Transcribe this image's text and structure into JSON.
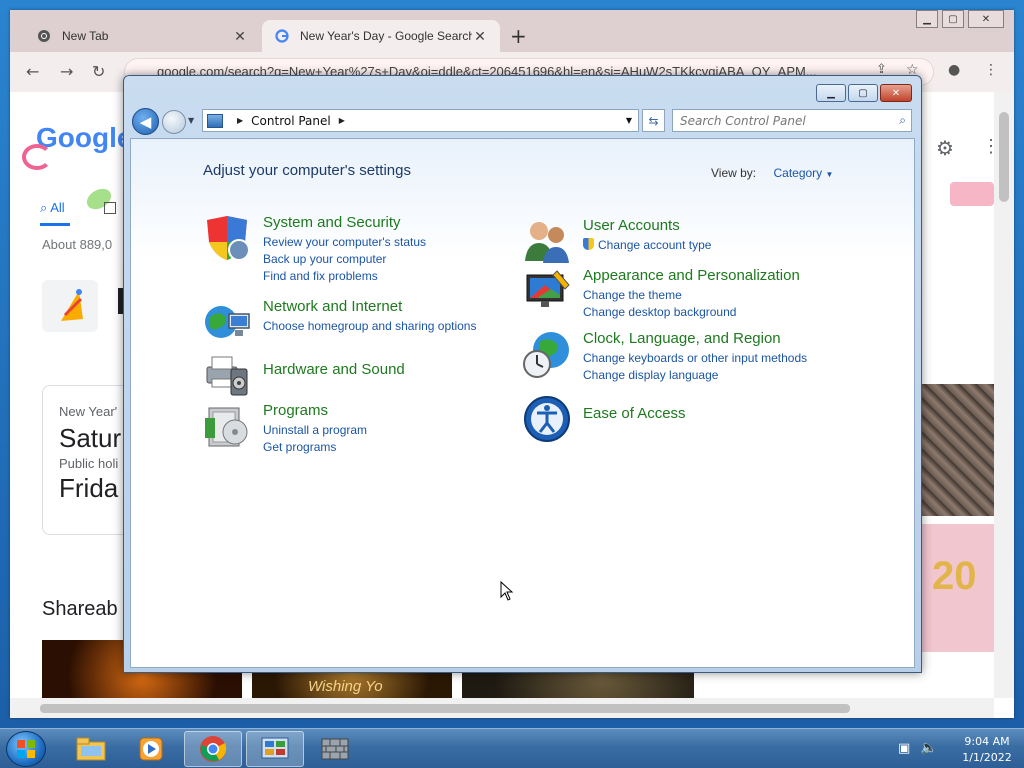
{
  "browser": {
    "tabs": [
      {
        "title": "New Tab",
        "favicon": "chrome-icon"
      },
      {
        "title": "New Year's Day - Google Search",
        "favicon": "google-icon"
      }
    ],
    "url": "google.com/search?q=New+Year%27s+Day&oi=ddle&ct=206451696&hl=en&si=AHuW2sTKkcvgiABA_OY_APM..."
  },
  "background_page": {
    "logo": "Google",
    "tab_all": "All",
    "result_count": "About 889,0",
    "card_label": "New Year'",
    "card_day1": "Satur",
    "card_sub": "Public holi",
    "card_day2": "Frida",
    "shareable": "Shareab",
    "banner_text": "Wishing Yo",
    "photo_text": "20"
  },
  "control_panel": {
    "breadcrumb": "Control Panel",
    "search_placeholder": "Search Control Panel",
    "heading": "Adjust your computer's settings",
    "view_by_label": "View by:",
    "view_by_value": "Category",
    "categories_left": [
      {
        "title": "System and Security",
        "icon": "shield-icon",
        "links": [
          "Review your computer's status",
          "Back up your computer",
          "Find and fix problems"
        ]
      },
      {
        "title": "Network and Internet",
        "icon": "network-globe-icon",
        "links": [
          "Choose homegroup and sharing options"
        ]
      },
      {
        "title": "Hardware and Sound",
        "icon": "printer-speaker-icon",
        "links": []
      },
      {
        "title": "Programs",
        "icon": "programs-icon",
        "links": [
          "Uninstall a program",
          "Get programs"
        ]
      }
    ],
    "categories_right": [
      {
        "title": "User Accounts",
        "icon": "users-icon",
        "links": [
          "Change account type"
        ]
      },
      {
        "title": "Appearance and Personalization",
        "icon": "appearance-icon",
        "links": [
          "Change the theme",
          "Change desktop background"
        ]
      },
      {
        "title": "Clock, Language, and Region",
        "icon": "clock-globe-icon",
        "links": [
          "Change keyboards or other input methods",
          "Change display language"
        ]
      },
      {
        "title": "Ease of Access",
        "icon": "ease-of-access-icon",
        "links": []
      }
    ]
  },
  "taskbar": {
    "time": "9:04 AM",
    "date": "1/1/2022"
  }
}
